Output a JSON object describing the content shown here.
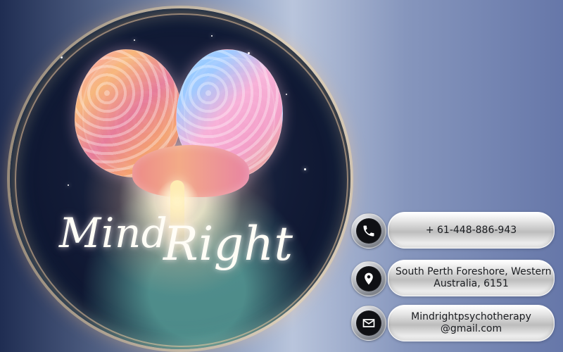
{
  "logo": {
    "word1": "Mind",
    "word2": "Right"
  },
  "contacts": {
    "phone": {
      "icon": "phone-icon",
      "text": "+ 61-448-886-943"
    },
    "address": {
      "icon": "location-pin-icon",
      "line1": "South Perth Foreshore, Western",
      "line2": "Australia, 6151"
    },
    "email": {
      "icon": "envelope-icon",
      "line1": "Mindrightpsychotherapy",
      "line2": "@gmail.com"
    }
  },
  "colors": {
    "accent_glow": "#FFE0A8",
    "icon_dark": "#0F1014",
    "pill_text": "#1A1C20"
  }
}
